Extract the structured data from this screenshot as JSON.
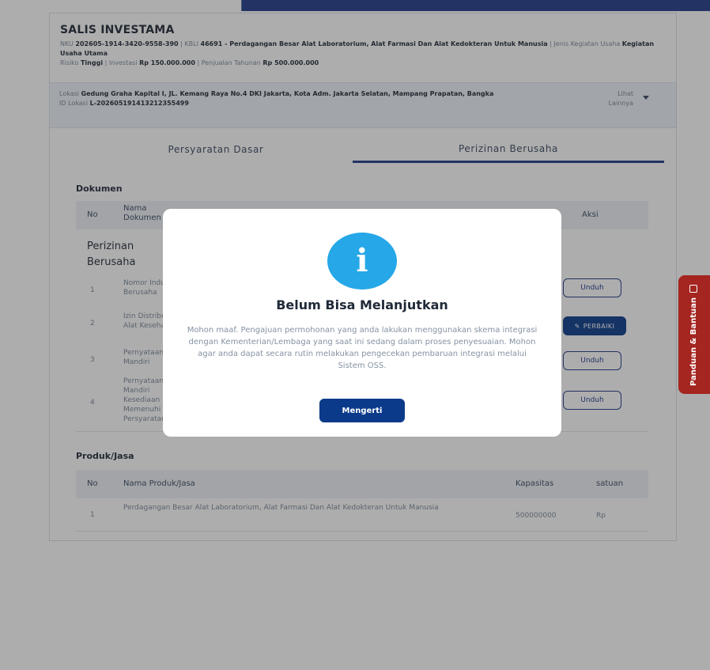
{
  "company": {
    "name": "SALIS INVESTAMA",
    "line1_label_nku": "NKU",
    "nku": "202605-1914-3420-9558-390",
    "line1_label_kbli": "KBLI",
    "kbli": "46691 - Perdagangan Besar Alat Laboratorium, Alat Farmasi Dan Alat Kedokteran Untuk Manusia",
    "label_jenis": "Jenis Kegiatan Usaha",
    "jenis": "Kegiatan Usaha Utama",
    "label_risiko": "Risiko",
    "risiko": "Tinggi",
    "label_investasi": "Investasi",
    "investasi": "Rp 150.000.000",
    "label_penjualan": "Penjualan Tahunan",
    "penjualan": "Rp 500.000.000"
  },
  "location": {
    "label": "Lokasi",
    "address": "Gedung Graha Kapital I, JL. Kemang Raya No.4 DKI Jakarta, Kota Adm. Jakarta Selatan, Mampang Prapatan, Bangka",
    "id_label": "ID Lokasi",
    "id": "L-202605191413212355499",
    "more_label": "Lihat Lainnya"
  },
  "tabs": [
    {
      "label": "Persyaratan Dasar"
    },
    {
      "label": "Perizinan Berusaha"
    }
  ],
  "documents": {
    "title": "Dokumen",
    "col_no": "No",
    "col_name": "Nama Dokumen",
    "col_action": "Aksi",
    "group": "Perizinan Berusaha",
    "rows": [
      {
        "no": "1",
        "name": "Nomor Induk Berusaha",
        "action": "Unduh"
      },
      {
        "no": "2",
        "name": "Izin Distribusi Alat Kesehatan",
        "action": "PERBAIKI"
      },
      {
        "no": "3",
        "name": "Pernyataan Mandiri",
        "action": "Unduh"
      },
      {
        "no": "4",
        "name": "Pernyataan Mandiri Kesediaan Memenuhi Persyaratan",
        "action": "Unduh"
      }
    ]
  },
  "products": {
    "title": "Produk/Jasa",
    "col_no": "No",
    "col_name": "Nama Produk/Jasa",
    "col_capacity": "Kapasitas",
    "col_unit": "satuan",
    "rows": [
      {
        "no": "1",
        "name": "Perdagangan Besar Alat Laboratorium, Alat Farmasi Dan Alat Kedokteran Untuk Manusia",
        "capacity": "500000000",
        "unit": "Rp"
      }
    ]
  },
  "side_tab": {
    "label": "Panduan & Bantuan"
  },
  "modal": {
    "icon": "info-icon",
    "icon_glyph": "i",
    "title": "Belum Bisa Melanjutkan",
    "message": "Mohon maaf. Pengajuan permohonan yang anda lakukan menggunakan skema integrasi dengan Kementerian/Lembaga yang saat ini sedang dalam proses penyesuaian. Mohon agar anda dapat secara rutin melakukan pengecekan pembaruan integrasi melalui Sistem OSS.",
    "button": "Mengerti"
  },
  "colors": {
    "primary": "#0b3a8a",
    "info": "#25a7e8",
    "side_tab": "#a52520"
  }
}
